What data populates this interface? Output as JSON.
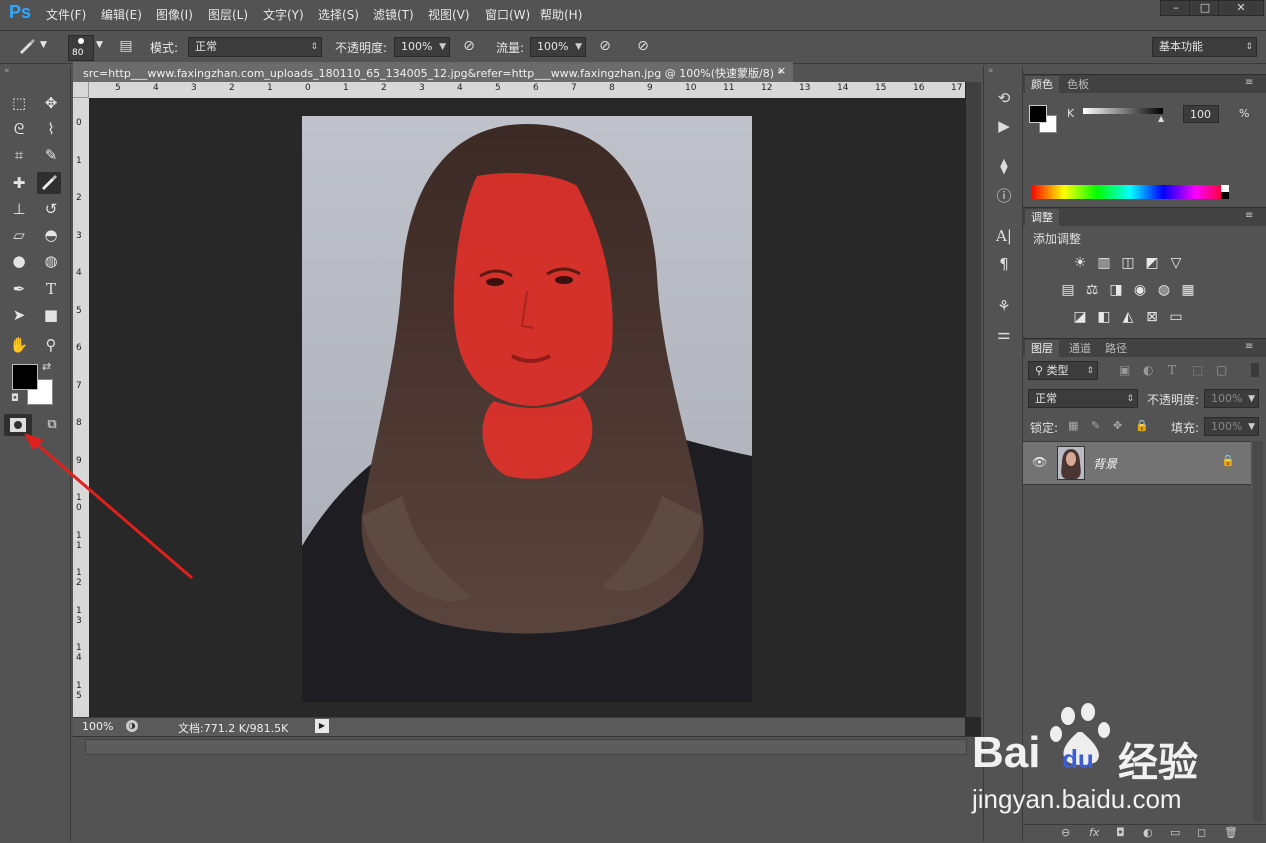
{
  "app": {
    "logo": "Ps"
  },
  "menu": [
    "文件(F)",
    "编辑(E)",
    "图像(I)",
    "图层(L)",
    "文字(Y)",
    "选择(S)",
    "滤镜(T)",
    "视图(V)",
    "窗口(W)",
    "帮助(H)"
  ],
  "window_controls": {
    "minimize": "–",
    "restore": "□",
    "close": "✕"
  },
  "options_bar": {
    "brush_size": "80",
    "mode_label": "模式:",
    "mode_value": "正常",
    "opacity_label": "不透明度:",
    "opacity_value": "100%",
    "flow_label": "流量:",
    "flow_value": "100%",
    "workspace": "基本功能"
  },
  "document": {
    "tab_title": "src=http___www.faxingzhan.com_uploads_180110_65_134005_12.jpg&refer=http___www.faxingzhan.jpg @ 100%(快速蒙版/8) *",
    "tab_close": "×",
    "ruler_h": [
      "5",
      "4",
      "3",
      "2",
      "1",
      "0",
      "1",
      "2",
      "3",
      "4",
      "5",
      "6",
      "7",
      "8",
      "9",
      "10",
      "11",
      "12",
      "13",
      "14",
      "15",
      "16",
      "17"
    ],
    "ruler_v": [
      "0",
      "1",
      "2",
      "3",
      "4",
      "5",
      "6",
      "7",
      "8",
      "9",
      "1\n0",
      "1\n1",
      "1\n2",
      "1\n3",
      "1\n4",
      "1\n5"
    ],
    "zoom": "100%",
    "doc_size": "文档:771.2 K/981.5K"
  },
  "color_panel": {
    "tabs": [
      "颜色",
      "色板"
    ],
    "channel": "K",
    "value": "100",
    "unit": "%"
  },
  "adjust_panel": {
    "tab": "调整",
    "title": "添加调整",
    "row1": [
      "☀",
      "▥",
      "◫",
      "◩",
      "▽"
    ],
    "row2": [
      "▤",
      "⚖",
      "◨",
      "◉",
      "◍",
      "▦"
    ],
    "row3": [
      "◪",
      "◧",
      "◭",
      "⊠",
      "▭"
    ]
  },
  "layers_panel": {
    "tabs": [
      "图层",
      "通道",
      "路径"
    ],
    "filter_type": "类型",
    "blend_mode": "正常",
    "opacity_label": "不透明度:",
    "opacity_value": "100%",
    "lock_label": "锁定:",
    "fill_label": "填充:",
    "fill_value": "100%",
    "layer_name": "背景",
    "footer_icons": [
      "⊖",
      "fx",
      "◘",
      "◐",
      "▭",
      "◻",
      "🗑"
    ]
  },
  "watermark": {
    "brand": "Bai",
    "brand2": "du",
    "site_cn": "经验",
    "url": "jingyan.baidu.com"
  },
  "colors": {
    "ui_bg": "#535353",
    "canvas_bg": "#282828",
    "mask_red": "#e8312b",
    "arrow_red": "#e0201c",
    "ps_blue": "#31a8ff"
  }
}
